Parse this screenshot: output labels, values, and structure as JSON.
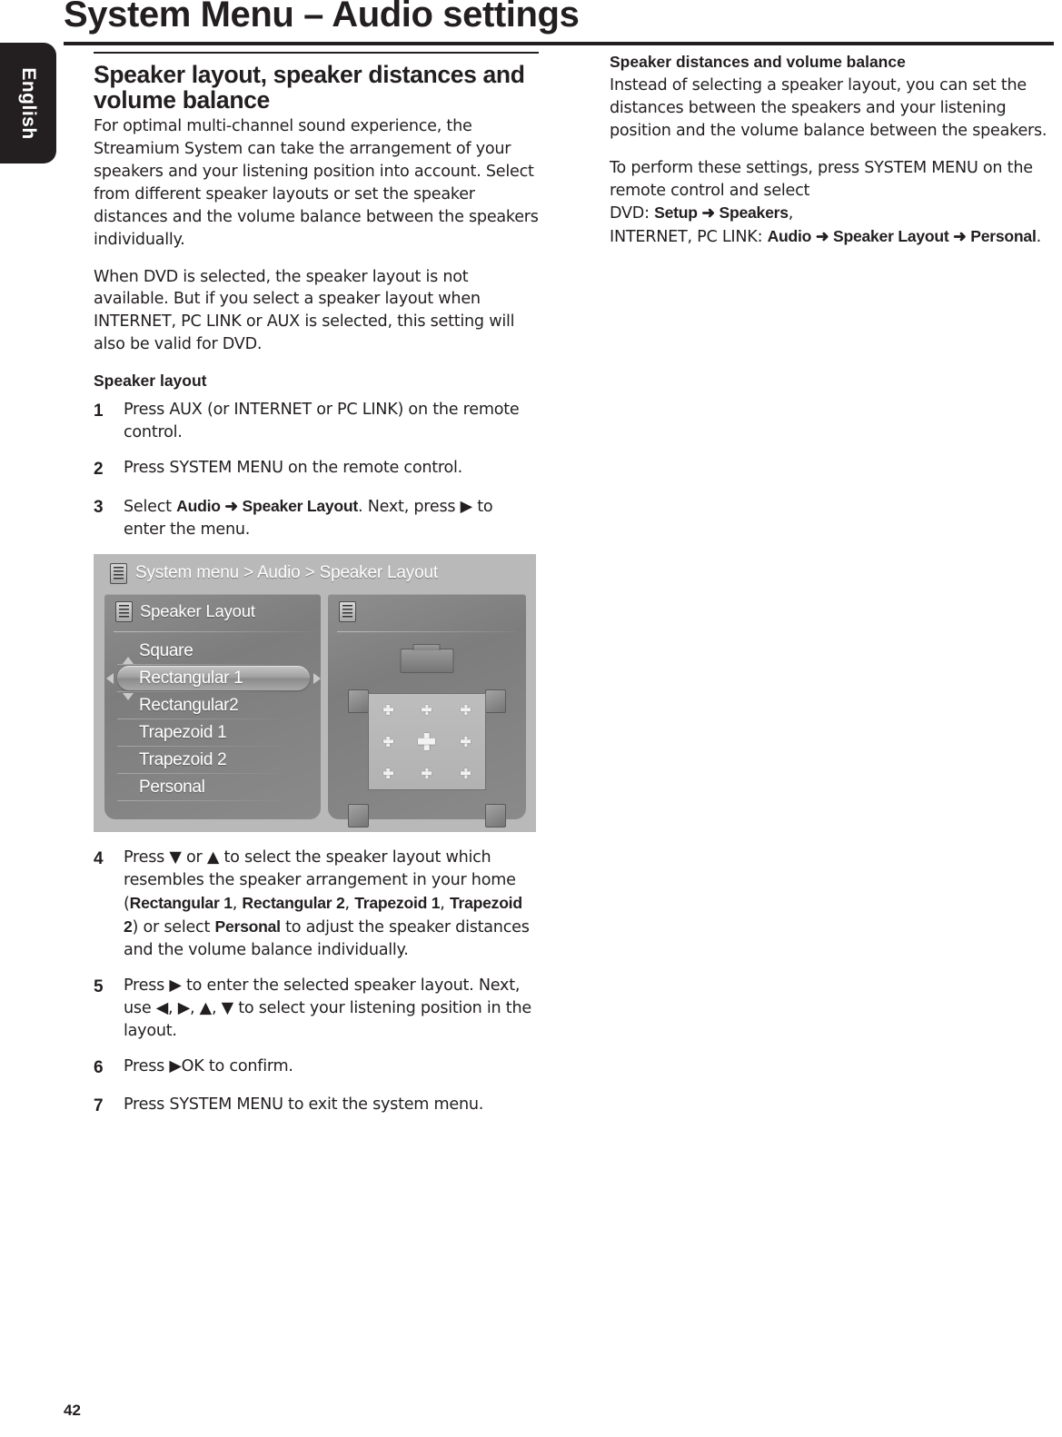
{
  "language_tab": "English",
  "page_title": "System Menu – Audio settings",
  "page_number": "42",
  "left_column": {
    "section_heading": "Speaker layout, speaker distances and volume balance",
    "paragraph_1": "For optimal multi-channel sound experience, the Streamium System can take the arrangement of your speakers and your listening position into account. Select from different speaker layouts or set the speaker distances and the volume balance between the speakers individually.",
    "paragraph_2": "When DVD is selected, the speaker layout is not available. But if you select a speaker layout when INTERNET, PC LINK or AUX is selected, this setting will also be valid for DVD.",
    "sub_heading": "Speaker layout",
    "steps": [
      {
        "number": "1",
        "text_parts": [
          {
            "t": "Press AUX (or INTERNET or PC LINK) on the remote control.",
            "b": false
          }
        ]
      },
      {
        "number": "2",
        "text_parts": [
          {
            "t": "Press SYSTEM MENU on the remote control.",
            "b": false
          }
        ]
      },
      {
        "number": "3",
        "text_parts": [
          {
            "t": "Select ",
            "b": false
          },
          {
            "t": "Audio",
            "b": true
          },
          {
            "t": " ➜ ",
            "b": true
          },
          {
            "t": "Speaker Layout",
            "b": true
          },
          {
            "t": ". Next, press ▶ to enter the menu.",
            "b": false
          }
        ]
      },
      {
        "number": "4",
        "text_parts": [
          {
            "t": "Press ▼ or ▲ to select the speaker layout which resembles the speaker arrangement in your home (",
            "b": false
          },
          {
            "t": "Rectangular 1",
            "b": true
          },
          {
            "t": ", ",
            "b": false
          },
          {
            "t": "Rectangular 2",
            "b": true
          },
          {
            "t": ", ",
            "b": false
          },
          {
            "t": "Trapezoid 1",
            "b": true
          },
          {
            "t": ", ",
            "b": false
          },
          {
            "t": "Trapezoid 2",
            "b": true
          },
          {
            "t": ") or select ",
            "b": false
          },
          {
            "t": "Personal",
            "b": true
          },
          {
            "t": " to adjust the speaker distances and the volume balance individually.",
            "b": false
          }
        ]
      },
      {
        "number": "5",
        "text_parts": [
          {
            "t": "Press ▶ to enter the selected speaker layout. Next, use ◀, ▶, ▲, ▼ to select your listening position in the layout.",
            "b": false
          }
        ]
      },
      {
        "number": "6",
        "text_parts": [
          {
            "t": "Press ▶OK to confirm.",
            "b": false
          }
        ]
      },
      {
        "number": "7",
        "text_parts": [
          {
            "t": "Press SYSTEM MENU to exit the system menu.",
            "b": false
          }
        ]
      }
    ]
  },
  "right_column": {
    "sub_heading": "Speaker distances and volume balance",
    "paragraph_1": "Instead of selecting a speaker layout, you can set the distances between the speakers and your listening position and the volume balance between the speakers.",
    "paragraph_2_parts": [
      {
        "t": "To perform these settings, press SYSTEM MENU on the remote control and select",
        "b": false
      },
      {
        "br": true
      },
      {
        "t": "DVD: ",
        "b": false
      },
      {
        "t": "Setup",
        "b": true
      },
      {
        "t": " ➜ ",
        "b": true
      },
      {
        "t": "Speakers",
        "b": true
      },
      {
        "t": ",",
        "b": false
      },
      {
        "br": true
      },
      {
        "t": "INTERNET, PC LINK: ",
        "b": false
      },
      {
        "t": "Audio",
        "b": true
      },
      {
        "t": " ➜ ",
        "b": true
      },
      {
        "t": "Speaker Layout",
        "b": true
      },
      {
        "t": " ➜ ",
        "b": true
      },
      {
        "t": "Personal",
        "b": true
      },
      {
        "t": ".",
        "b": false
      }
    ]
  },
  "tv_screenshot": {
    "breadcrumb": "System menu > Audio > Speaker Layout",
    "panel_title": "Speaker Layout",
    "menu_items": [
      {
        "label": "Square",
        "selected": false
      },
      {
        "label": "Rectangular 1",
        "selected": true
      },
      {
        "label": "Rectangular2",
        "selected": false
      },
      {
        "label": "Trapezoid 1",
        "selected": false
      },
      {
        "label": "Trapezoid 2",
        "selected": false
      },
      {
        "label": "Personal",
        "selected": false
      }
    ],
    "diagram": {
      "speakers": [
        "front-left",
        "front-right",
        "rear-left",
        "rear-right"
      ],
      "display": "tv",
      "listening_positions": 9,
      "selected_position_index": 4
    },
    "colors": {
      "background": "#b9b9b9",
      "panel": "#828282",
      "highlight_pill": "#bdbdbd",
      "text": "#ffffff"
    }
  }
}
